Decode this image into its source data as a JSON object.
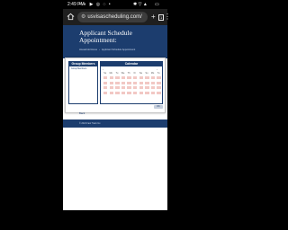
{
  "status_bar": {
    "time": "2:49 PM",
    "left_icons": "▪ ◐ ▶ ◎ ◌ •",
    "right_icons": "✱ ▽ ▲",
    "battery": "▭"
  },
  "browser": {
    "url": "usvisascheduling.com/",
    "new_tab_label": "+",
    "tab_count": "1",
    "menu_label": "⋮"
  },
  "hero": {
    "title": "Applicant Schedule Appointment:",
    "breadcrumb_home": "Household Home",
    "breadcrumb_sep": "›",
    "breadcrumb_current": "Applicant Schedule Appointment"
  },
  "modal": {
    "group_title": "Group Members",
    "group_sub": "Group Members",
    "calendar_title": "Calendar",
    "prev": "‹",
    "month": "",
    "next": "›",
    "dow": [
      "Su",
      "Mo",
      "Tu",
      "We",
      "Th",
      "Fr",
      "Sa",
      "Su",
      "Mo",
      "Tu"
    ],
    "ok_label": "OK"
  },
  "below": {
    "link": "Back"
  },
  "footer": {
    "copy": "© 2024 Fast Track Inc."
  },
  "colors": {
    "brand_navy": "#1c3d6e",
    "calendar_unavailable": "#f2c8c4"
  }
}
